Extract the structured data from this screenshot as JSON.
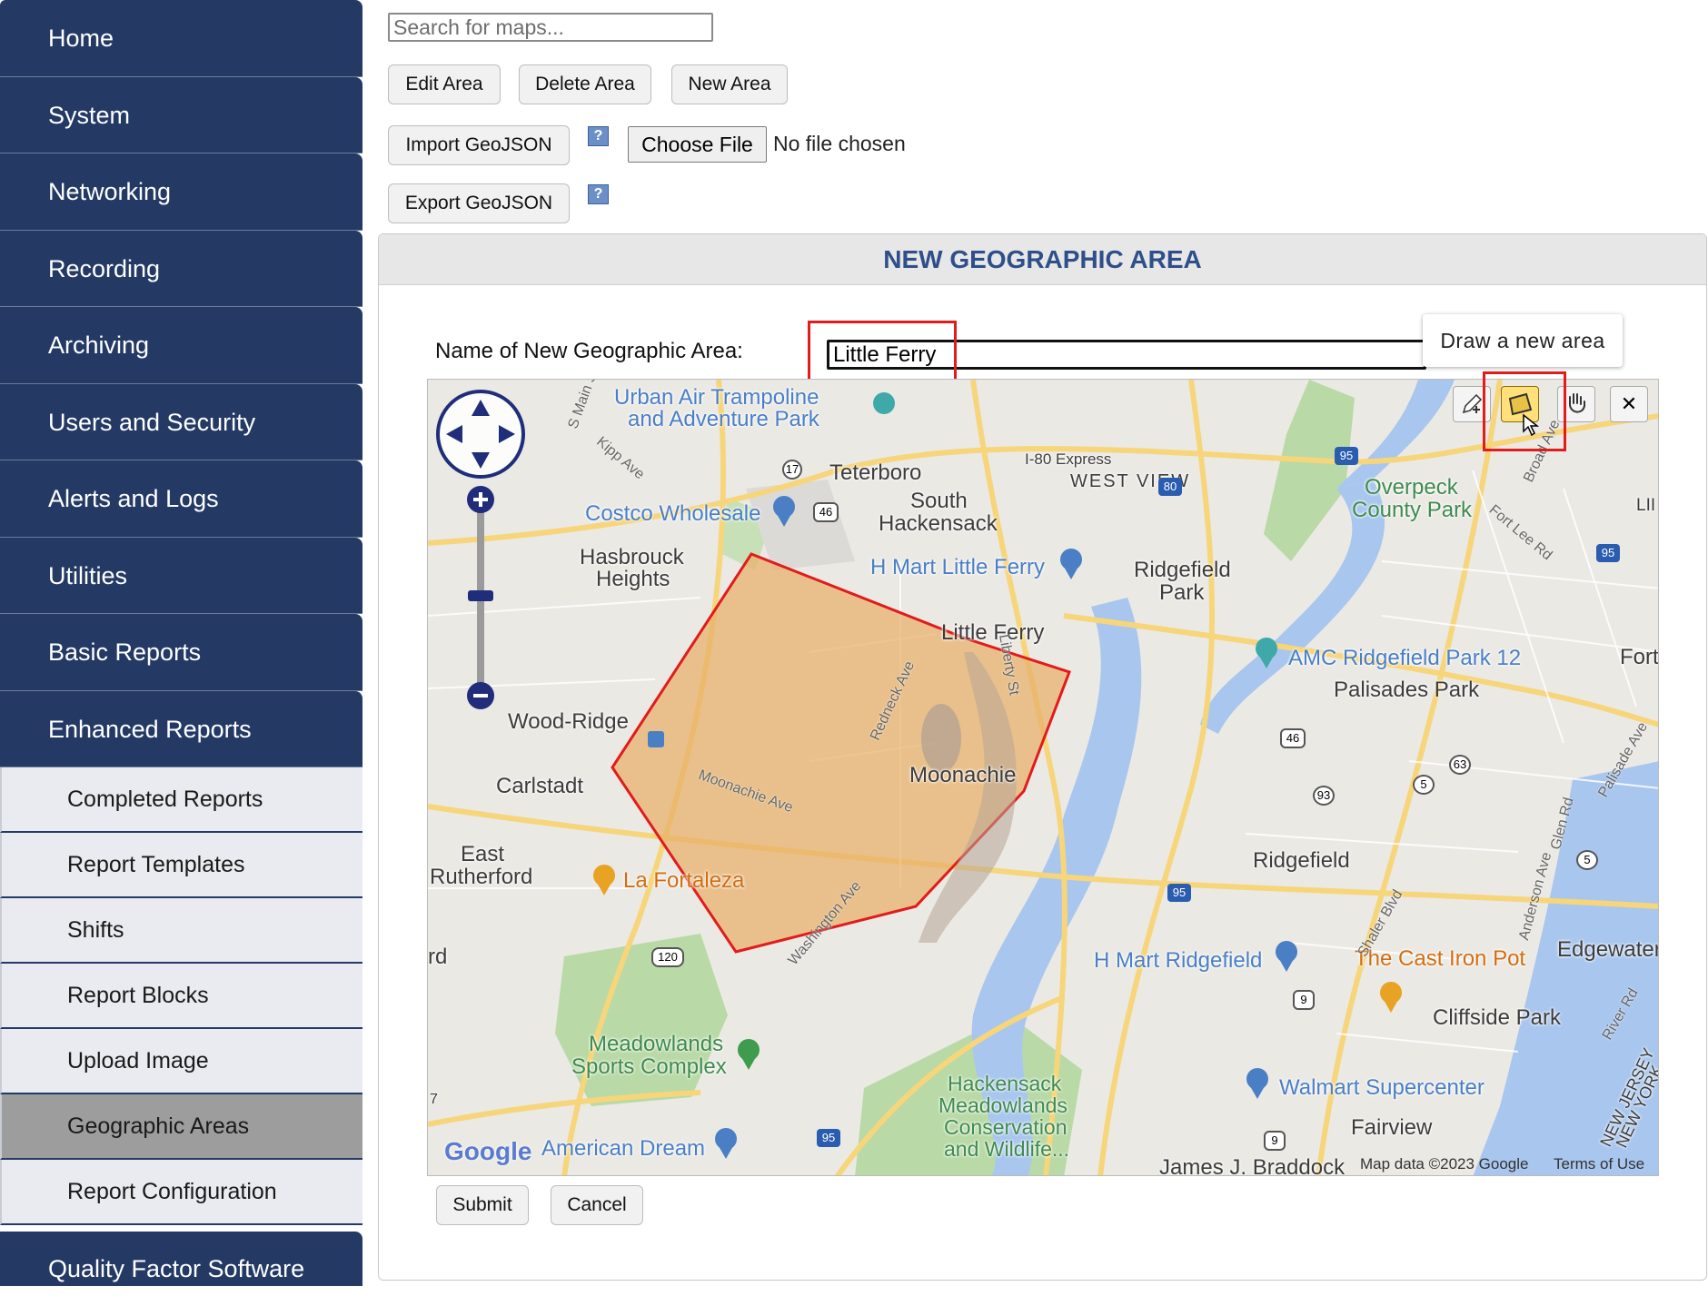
{
  "sidebar": {
    "main_items": [
      {
        "label": "Home"
      },
      {
        "label": "System"
      },
      {
        "label": "Networking"
      },
      {
        "label": "Recording"
      },
      {
        "label": "Archiving"
      },
      {
        "label": "Users and Security"
      },
      {
        "label": "Alerts and Logs"
      },
      {
        "label": "Utilities"
      },
      {
        "label": "Basic Reports"
      },
      {
        "label": "Enhanced Reports"
      }
    ],
    "sub_items": [
      {
        "label": "Completed Reports"
      },
      {
        "label": "Report Templates"
      },
      {
        "label": "Shifts"
      },
      {
        "label": "Report Blocks"
      },
      {
        "label": "Upload Image"
      },
      {
        "label": "Geographic Areas",
        "active": true
      },
      {
        "label": "Report Configuration"
      }
    ],
    "footer_item": "Quality Factor Software"
  },
  "toolbar": {
    "search_placeholder": "Search for maps...",
    "edit_area": "Edit Area",
    "delete_area": "Delete Area",
    "new_area": "New Area",
    "import_geojson": "Import GeoJSON",
    "export_geojson": "Export GeoJSON",
    "help_glyph": "?",
    "choose_file": "Choose File",
    "no_file": "No file chosen"
  },
  "panel": {
    "title": "NEW GEOGRAPHIC AREA",
    "name_label": "Name of New Geographic Area:",
    "name_value": "Little Ferry",
    "submit": "Submit",
    "cancel": "Cancel"
  },
  "map": {
    "tooltip": "Draw a new area",
    "tools": [
      {
        "icon": "pencil-edit-icon"
      },
      {
        "icon": "draw-polygon-icon",
        "active": true
      },
      {
        "icon": "pan-hand-icon"
      },
      {
        "icon": "close-icon",
        "glyph": "✕"
      }
    ],
    "polygon_fill": "#e8b06a",
    "polygon_stroke": "#e21b1b",
    "labels": {
      "urban_air": "Urban Air Trampoline",
      "urban_air2": "and Adventure Park",
      "teterboro": "Teterboro",
      "south_hack": "South",
      "south_hack2": "Hackensack",
      "west_view": "WEST VIEW",
      "i80": "I-80 Express",
      "overpeck": "Overpeck",
      "overpeck2": "County Park",
      "costco": "Costco Wholesale",
      "hasbrouck": "Hasbrouck",
      "hasbrouck2": "Heights",
      "hmart_lf": "H Mart Little Ferry",
      "ridgefield_park": "Ridgefield",
      "ridgefield_park2": "Park",
      "little_ferry": "Little Ferry",
      "amc": "AMC Ridgefield Park 12",
      "palisades": "Palisades Park",
      "fort": "Fort",
      "wood_ridge": "Wood-Ridge",
      "carlstadt": "Carlstadt",
      "moonachie": "Moonachie",
      "east_ruth": "East",
      "east_ruth2": "Rutherford",
      "la_fortaleza": "La Fortaleza",
      "ridgefield": "Ridgefield",
      "hmart_rf": "H Mart Ridgefield",
      "cast_iron": "The Cast Iron Pot",
      "edgewater": "Edgewater",
      "cliffside": "Cliffside Park",
      "meadowlands": "Meadowlands",
      "meadowlands2": "Sports Complex",
      "hackensack_m": "Hackensack",
      "hackensack_m2": "Meadowlands",
      "hackensack_m3": "Conservation",
      "hackensack_m4": "and Wildlife...",
      "walmart": "Walmart Supercenter",
      "fairview": "Fairview",
      "american_dream": "American Dream",
      "james": "James J. Braddock",
      "map_data": "Map data ©2023 Google",
      "terms": "Terms of Use",
      "google": "Google",
      "s_main": "S Main St",
      "kipp": "Kipp Ave",
      "moonachie_ave": "Moonachie Ave",
      "redneck": "Redneck Ave",
      "liberty": "Liberty St",
      "washington": "Washington Ave",
      "shaler": "Shaler Blvd",
      "anderson": "Anderson Ave",
      "glen": "Glen Rd",
      "fort_lee": "Fort Lee Rd",
      "broad": "Broad Ave",
      "palisade_ave": "Palisade Ave",
      "river_rd": "River Rd",
      "nj": "NEW JERSEY",
      "ny": "NEW YORK",
      "rd": "rd",
      "lil": "LII",
      "seven": "7"
    },
    "shields": [
      "17",
      "46",
      "80",
      "95",
      "95",
      "46",
      "63",
      "93",
      "5",
      "5",
      "95",
      "120",
      "9",
      "9",
      "95"
    ]
  }
}
